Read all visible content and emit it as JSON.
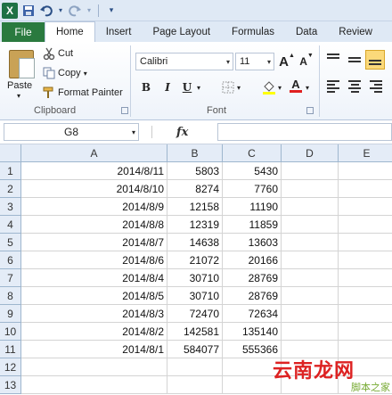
{
  "qat": {
    "app_icon": "X"
  },
  "tabs": [
    "File",
    "Home",
    "Insert",
    "Page Layout",
    "Formulas",
    "Data",
    "Review"
  ],
  "ribbon": {
    "paste_label": "Paste",
    "cut_label": "Cut",
    "copy_label": "Copy",
    "format_painter_label": "Format Painter",
    "clipboard_group": "Clipboard",
    "font_name": "Calibri",
    "font_size": "11",
    "font_group": "Font",
    "bold": "B",
    "italic": "I",
    "underline": "U",
    "grow_font": "A",
    "shrink_font": "A",
    "font_color": "A"
  },
  "formula_bar": {
    "name_box": "G8",
    "fx": "fx",
    "value": ""
  },
  "columns": [
    "A",
    "B",
    "C",
    "D",
    "E"
  ],
  "rows": [
    {
      "num": "1",
      "a": "2014/8/11",
      "b": "5803",
      "c": "5430"
    },
    {
      "num": "2",
      "a": "2014/8/10",
      "b": "8274",
      "c": "7760"
    },
    {
      "num": "3",
      "a": "2014/8/9",
      "b": "12158",
      "c": "11190"
    },
    {
      "num": "4",
      "a": "2014/8/8",
      "b": "12319",
      "c": "11859"
    },
    {
      "num": "5",
      "a": "2014/8/7",
      "b": "14638",
      "c": "13603"
    },
    {
      "num": "6",
      "a": "2014/8/6",
      "b": "21072",
      "c": "20166"
    },
    {
      "num": "7",
      "a": "2014/8/4",
      "b": "30710",
      "c": "28769"
    },
    {
      "num": "8",
      "a": "2014/8/5",
      "b": "30710",
      "c": "28769"
    },
    {
      "num": "9",
      "a": "2014/8/3",
      "b": "72470",
      "c": "72634"
    },
    {
      "num": "10",
      "a": "2014/8/2",
      "b": "142581",
      "c": "135140"
    },
    {
      "num": "11",
      "a": "2014/8/1",
      "b": "584077",
      "c": "555366"
    },
    {
      "num": "12",
      "a": "",
      "b": "",
      "c": ""
    },
    {
      "num": "13",
      "a": "",
      "b": "",
      "c": ""
    }
  ],
  "watermark": {
    "main": "云南龙网",
    "sub": "脚本之家"
  },
  "colors": {
    "file_tab": "#2a7a3f",
    "header_bg": "#e4ecf7",
    "ribbon_bg": "#dfe9f5"
  }
}
